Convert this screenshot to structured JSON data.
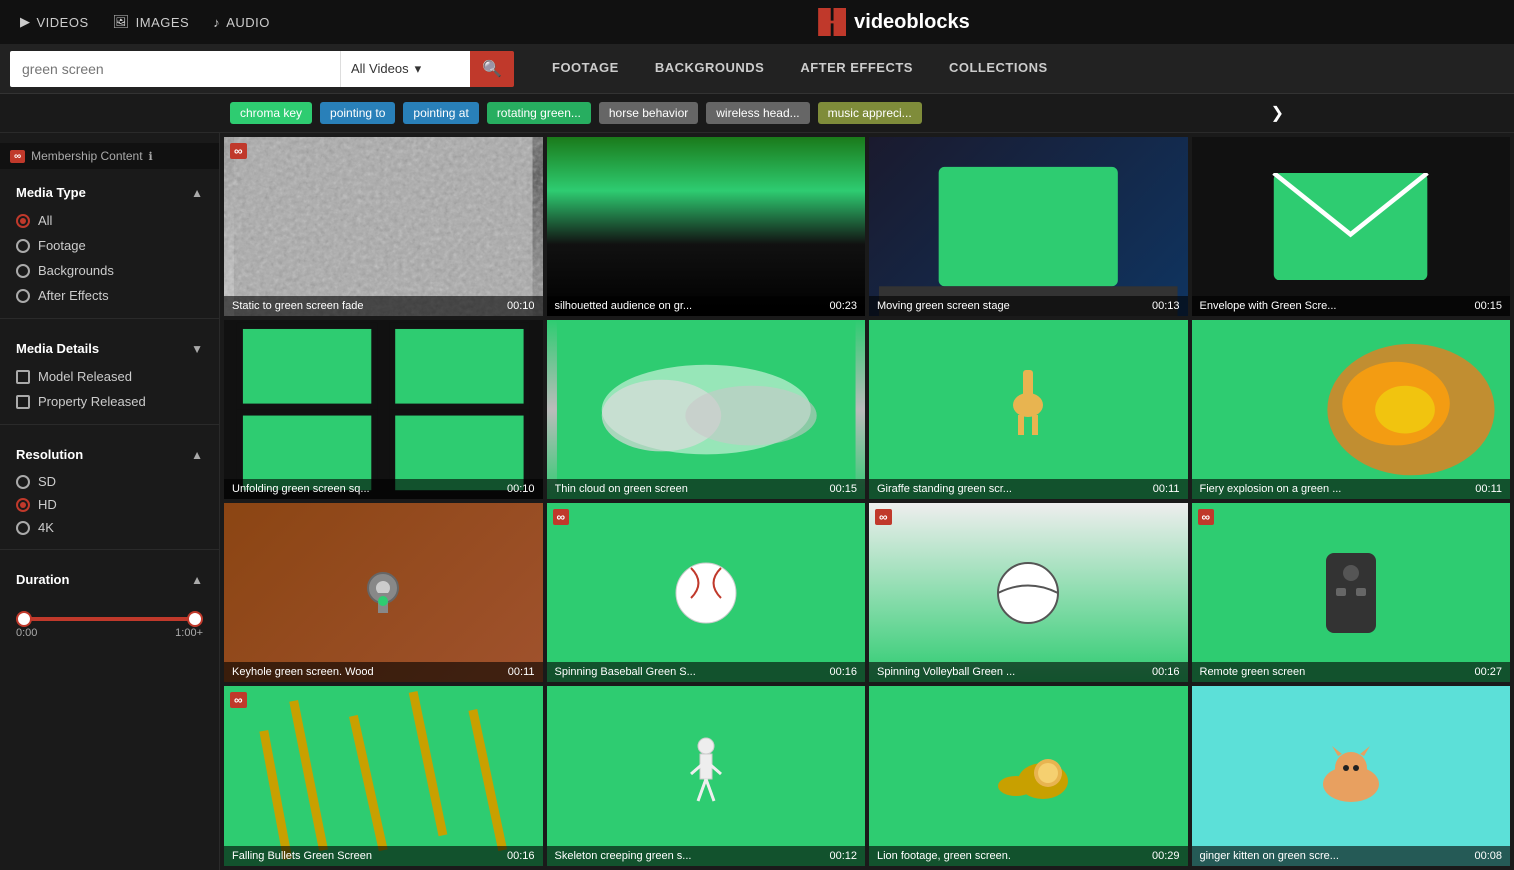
{
  "topNav": {
    "items": [
      {
        "id": "videos",
        "label": "VIDEOS",
        "icon": "video-icon"
      },
      {
        "id": "images",
        "label": "IMAGES",
        "icon": "image-icon"
      },
      {
        "id": "audio",
        "label": "AUDIO",
        "icon": "audio-icon"
      }
    ],
    "logo": "videoblocks"
  },
  "searchBar": {
    "placeholder": "green screen",
    "dropdownValue": "All Videos",
    "navItems": [
      {
        "id": "footage",
        "label": "FOOTAGE",
        "active": false
      },
      {
        "id": "backgrounds",
        "label": "BACKGROUNDS",
        "active": false
      },
      {
        "id": "aftereffects",
        "label": "AFTER EFFECTS",
        "active": false
      },
      {
        "id": "collections",
        "label": "COLLECTIONS",
        "active": false
      }
    ]
  },
  "tags": [
    {
      "id": "chroma",
      "label": "chroma key",
      "color": "green"
    },
    {
      "id": "pointing-to",
      "label": "pointing to",
      "color": "blue"
    },
    {
      "id": "pointing-at",
      "label": "pointing at",
      "color": "blue"
    },
    {
      "id": "rotating-green",
      "label": "rotating green...",
      "color": "green2"
    },
    {
      "id": "horse",
      "label": "horse behavior",
      "color": "gray"
    },
    {
      "id": "wireless",
      "label": "wireless head...",
      "color": "gray"
    },
    {
      "id": "music",
      "label": "music appreci...",
      "color": "olive"
    }
  ],
  "sidebar": {
    "membershipLabel": "Membership Content",
    "mediaType": {
      "title": "Media Type",
      "options": [
        {
          "id": "all",
          "label": "All",
          "selected": true
        },
        {
          "id": "footage",
          "label": "Footage",
          "selected": false
        },
        {
          "id": "backgrounds",
          "label": "Backgrounds",
          "selected": false
        },
        {
          "id": "aftereffects",
          "label": "After Effects",
          "selected": false
        }
      ]
    },
    "mediaDetails": {
      "title": "Media Details",
      "options": [
        {
          "id": "model-released",
          "label": "Model Released",
          "checked": false
        },
        {
          "id": "property-released",
          "label": "Property Released",
          "checked": false
        }
      ]
    },
    "resolution": {
      "title": "Resolution",
      "options": [
        {
          "id": "sd",
          "label": "SD",
          "selected": false
        },
        {
          "id": "hd",
          "label": "HD",
          "selected": true
        },
        {
          "id": "4k",
          "label": "4K",
          "selected": false
        }
      ]
    },
    "duration": {
      "title": "Duration",
      "minLabel": "0:00",
      "maxLabel": "1:00+"
    }
  },
  "videoGrid": {
    "videos": [
      {
        "id": "v1",
        "title": "Static to green screen fade",
        "duration": "00:10",
        "membership": true,
        "thumbType": "static"
      },
      {
        "id": "v2",
        "title": "silhouetted audience on gr...",
        "duration": "00:23",
        "membership": false,
        "thumbType": "audience"
      },
      {
        "id": "v3",
        "title": "Moving green screen stage",
        "duration": "00:13",
        "membership": false,
        "thumbType": "stage"
      },
      {
        "id": "v4",
        "title": "Envelope with Green Scre...",
        "duration": "00:15",
        "membership": false,
        "thumbType": "envelope"
      },
      {
        "id": "v5",
        "title": "Unfolding green screen sq...",
        "duration": "00:10",
        "membership": false,
        "thumbType": "unfolding"
      },
      {
        "id": "v6",
        "title": "Thin cloud on green screen",
        "duration": "00:15",
        "membership": false,
        "thumbType": "cloud"
      },
      {
        "id": "v7",
        "title": "Giraffe standing green scr...",
        "duration": "00:11",
        "membership": false,
        "thumbType": "giraffe"
      },
      {
        "id": "v8",
        "title": "Fiery explosion on a green ...",
        "duration": "00:11",
        "membership": false,
        "thumbType": "explosion"
      },
      {
        "id": "v9",
        "title": "Keyhole green screen. Wood",
        "duration": "00:11",
        "membership": false,
        "thumbType": "keyhole"
      },
      {
        "id": "v10",
        "title": "Spinning Baseball Green S...",
        "duration": "00:16",
        "membership": true,
        "thumbType": "baseball"
      },
      {
        "id": "v11",
        "title": "Spinning Volleyball Green ...",
        "duration": "00:16",
        "membership": true,
        "thumbType": "volleyball"
      },
      {
        "id": "v12",
        "title": "Remote green screen",
        "duration": "00:27",
        "membership": true,
        "thumbType": "remote"
      },
      {
        "id": "v13",
        "title": "Falling Bullets Green Screen",
        "duration": "00:16",
        "membership": true,
        "thumbType": "bullets"
      },
      {
        "id": "v14",
        "title": "Skeleton creeping green s...",
        "duration": "00:12",
        "membership": false,
        "thumbType": "skeleton"
      },
      {
        "id": "v15",
        "title": "Lion footage, green screen.",
        "duration": "00:29",
        "membership": false,
        "thumbType": "lion"
      },
      {
        "id": "v16",
        "title": "ginger kitten on green scre...",
        "duration": "00:08",
        "membership": false,
        "thumbType": "kitten"
      }
    ]
  }
}
